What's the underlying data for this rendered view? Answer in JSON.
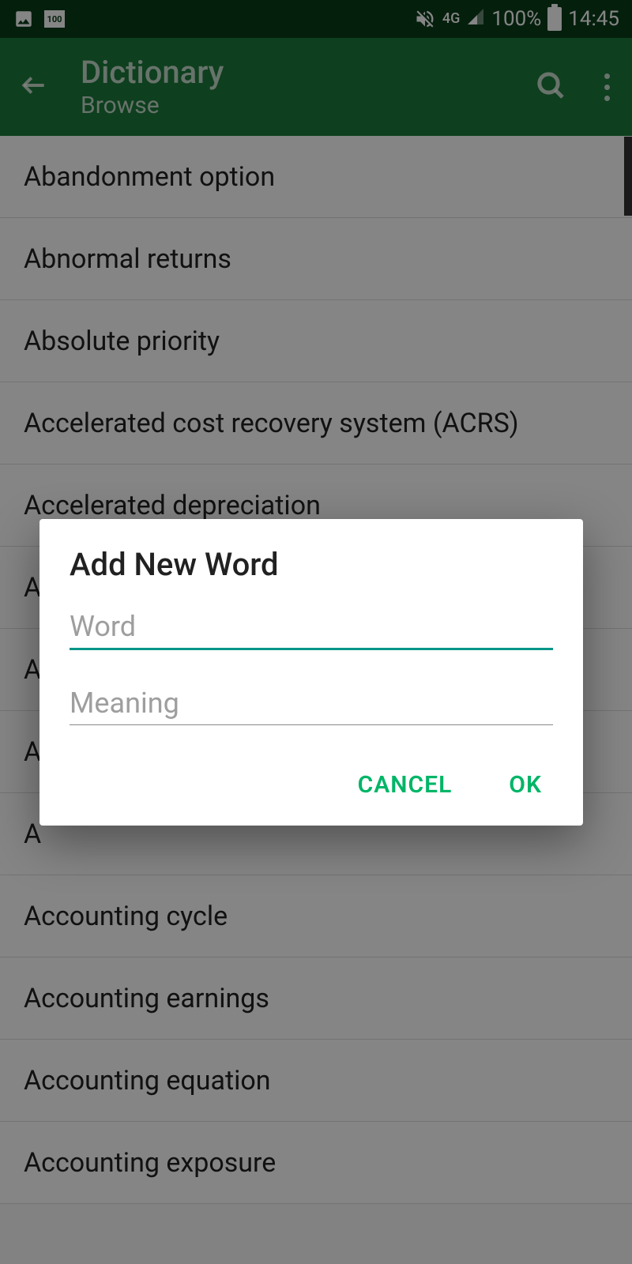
{
  "status": {
    "battery_small_text": "100",
    "network_label": "4G",
    "battery_percent": "100%",
    "time": "14:45"
  },
  "appbar": {
    "title": "Dictionary",
    "subtitle": "Browse"
  },
  "list": {
    "items": [
      {
        "label": "Abandonment option"
      },
      {
        "label": "Abnormal returns"
      },
      {
        "label": "Absolute priority"
      },
      {
        "label": "Accelerated cost recovery system (ACRS)"
      },
      {
        "label": "Accelerated depreciation"
      },
      {
        "label": "A"
      },
      {
        "label": "A"
      },
      {
        "label": "A"
      },
      {
        "label": "A"
      },
      {
        "label": "Accounting cycle"
      },
      {
        "label": "Accounting earnings"
      },
      {
        "label": "Accounting equation"
      },
      {
        "label": "Accounting exposure"
      }
    ]
  },
  "dialog": {
    "title": "Add New Word",
    "word_placeholder": "Word",
    "meaning_placeholder": "Meaning",
    "cancel_label": "CANCEL",
    "ok_label": "OK"
  }
}
